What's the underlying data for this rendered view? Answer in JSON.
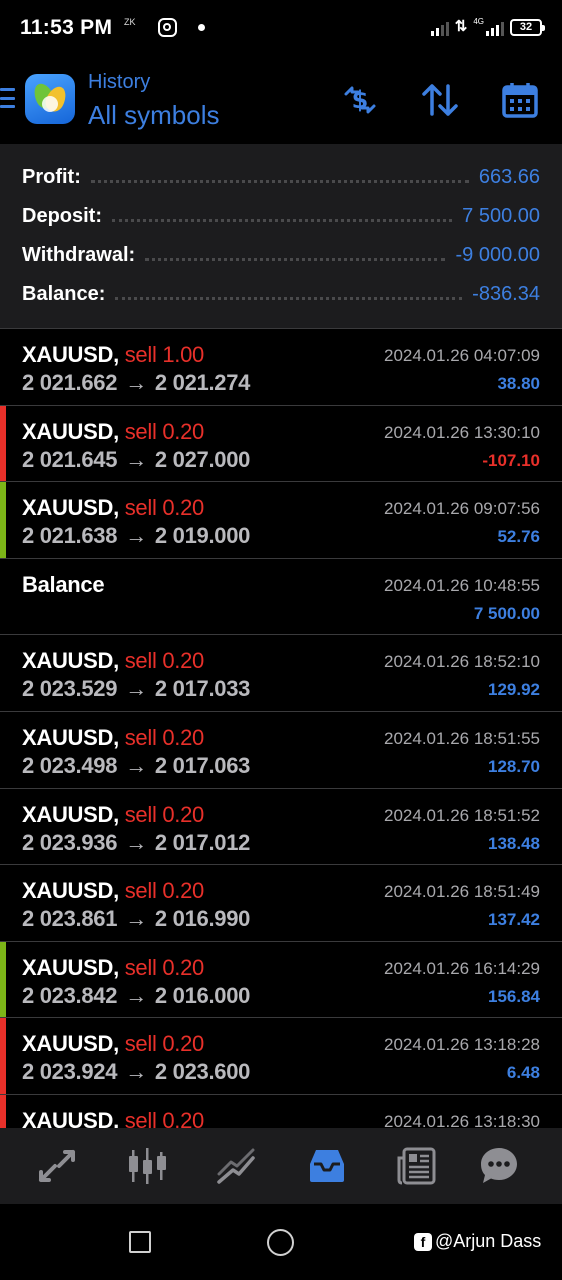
{
  "status_bar": {
    "time": "11:53 PM",
    "small_label": "ZK",
    "network": "4G",
    "battery": "32"
  },
  "header": {
    "subtitle": "History",
    "title": "All symbols",
    "icons": [
      "menu-icon",
      "metatrader-logo",
      "dollar-swap-icon",
      "sort-icon",
      "calendar-icon"
    ]
  },
  "summary": {
    "profit_label": "Profit:",
    "profit_value": "663.66",
    "deposit_label": "Deposit:",
    "deposit_value": "7 500.00",
    "withdrawal_label": "Withdrawal:",
    "withdrawal_value": "-9 000.00",
    "balance_label": "Balance:",
    "balance_value": "-836.34"
  },
  "colors": {
    "accent": "#3d7fe0",
    "loss": "#e8302a",
    "win_bar": "#7cb518",
    "background": "#000000",
    "panel": "#1c1c1e"
  },
  "trades": [
    {
      "symbol": "XAUUSD,",
      "side": "sell 1.00",
      "open": "2 021.662",
      "close": "2 021.274",
      "datetime": "2024.01.26 04:07:09",
      "pl": "38.80",
      "pl_sign": "pos",
      "marker": "none"
    },
    {
      "symbol": "XAUUSD,",
      "side": "sell 0.20",
      "open": "2 021.645",
      "close": "2 027.000",
      "datetime": "2024.01.26 13:30:10",
      "pl": "-107.10",
      "pl_sign": "neg",
      "marker": "loss"
    },
    {
      "symbol": "XAUUSD,",
      "side": "sell 0.20",
      "open": "2 021.638",
      "close": "2 019.000",
      "datetime": "2024.01.26 09:07:56",
      "pl": "52.76",
      "pl_sign": "pos",
      "marker": "win"
    },
    {
      "symbol": "Balance",
      "side": "",
      "open": "",
      "close": "",
      "datetime": "2024.01.26 10:48:55",
      "pl": "7 500.00",
      "pl_sign": "pos",
      "marker": "none"
    },
    {
      "symbol": "XAUUSD,",
      "side": "sell 0.20",
      "open": "2 023.529",
      "close": "2 017.033",
      "datetime": "2024.01.26 18:52:10",
      "pl": "129.92",
      "pl_sign": "pos",
      "marker": "none"
    },
    {
      "symbol": "XAUUSD,",
      "side": "sell 0.20",
      "open": "2 023.498",
      "close": "2 017.063",
      "datetime": "2024.01.26 18:51:55",
      "pl": "128.70",
      "pl_sign": "pos",
      "marker": "none"
    },
    {
      "symbol": "XAUUSD,",
      "side": "sell 0.20",
      "open": "2 023.936",
      "close": "2 017.012",
      "datetime": "2024.01.26 18:51:52",
      "pl": "138.48",
      "pl_sign": "pos",
      "marker": "none"
    },
    {
      "symbol": "XAUUSD,",
      "side": "sell 0.20",
      "open": "2 023.861",
      "close": "2 016.990",
      "datetime": "2024.01.26 18:51:49",
      "pl": "137.42",
      "pl_sign": "pos",
      "marker": "none"
    },
    {
      "symbol": "XAUUSD,",
      "side": "sell 0.20",
      "open": "2 023.842",
      "close": "2 016.000",
      "datetime": "2024.01.26 16:14:29",
      "pl": "156.84",
      "pl_sign": "pos",
      "marker": "win"
    },
    {
      "symbol": "XAUUSD,",
      "side": "sell 0.20",
      "open": "2 023.924",
      "close": "2 023.600",
      "datetime": "2024.01.26 13:18:28",
      "pl": "6.48",
      "pl_sign": "pos",
      "marker": "loss"
    },
    {
      "symbol": "XAUUSD,",
      "side": "sell 0.20",
      "open": "",
      "close": "",
      "datetime": "2024.01.26 13:18:30",
      "pl": "",
      "pl_sign": "pos",
      "marker": "loss"
    }
  ],
  "price_arrow": "→",
  "bottom_nav": {
    "icons": [
      "quotes-icon",
      "chart-icon",
      "trade-icon",
      "history-icon",
      "news-icon",
      "chat-icon"
    ],
    "active": "history-icon"
  },
  "watermark": "@Arjun Dass"
}
